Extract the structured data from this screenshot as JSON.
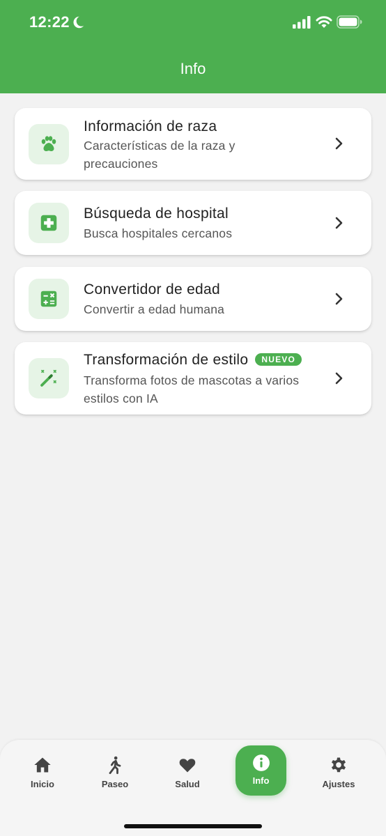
{
  "status_bar": {
    "time": "12:22"
  },
  "header": {
    "title": "Info"
  },
  "cards": [
    {
      "title": "Información de raza",
      "subtitle": "Características de la raza y precauciones",
      "icon": "paw-icon"
    },
    {
      "title": "Búsqueda de hospital",
      "subtitle": "Busca hospitales cercanos",
      "icon": "medical-plus-icon"
    },
    {
      "title": "Convertidor de edad",
      "subtitle": "Convertir a edad humana",
      "icon": "calculator-icon"
    },
    {
      "title": "Transformación de estilo",
      "badge": "NUEVO",
      "subtitle": "Transforma fotos de mascotas a varios estilos con IA",
      "icon": "magic-wand-icon"
    }
  ],
  "tabbar": {
    "items": [
      {
        "label": "Inicio",
        "icon": "home-icon"
      },
      {
        "label": "Paseo",
        "icon": "walking-icon"
      },
      {
        "label": "Salud",
        "icon": "heart-icon"
      },
      {
        "label": "Info",
        "icon": "info-icon",
        "active": true
      },
      {
        "label": "Ajustes",
        "icon": "gear-icon"
      }
    ]
  },
  "colors": {
    "primary": "#4caf50",
    "icon_bg": "#e6f4e6",
    "background": "#f2f2f2"
  }
}
